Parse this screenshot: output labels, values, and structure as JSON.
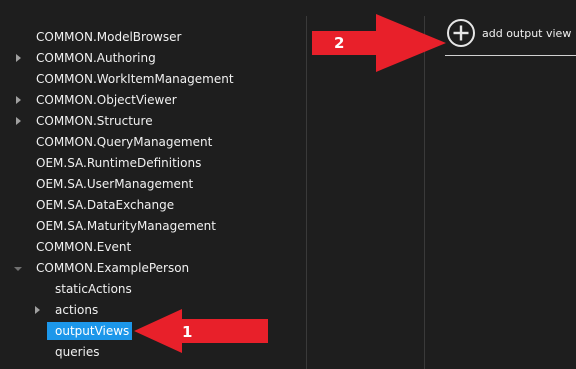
{
  "tree": {
    "items": [
      {
        "label": "COMMON.ModelBrowser",
        "expander": "none"
      },
      {
        "label": "COMMON.Authoring",
        "expander": "collapsed"
      },
      {
        "label": "COMMON.WorkItemManagement",
        "expander": "none"
      },
      {
        "label": "COMMON.ObjectViewer",
        "expander": "collapsed"
      },
      {
        "label": "COMMON.Structure",
        "expander": "collapsed"
      },
      {
        "label": "COMMON.QueryManagement",
        "expander": "none"
      },
      {
        "label": "OEM.SA.RuntimeDefinitions",
        "expander": "none"
      },
      {
        "label": "OEM.SA.UserManagement",
        "expander": "none"
      },
      {
        "label": "OEM.SA.DataExchange",
        "expander": "none"
      },
      {
        "label": "OEM.SA.MaturityManagement",
        "expander": "none"
      },
      {
        "label": "COMMON.Event",
        "expander": "none"
      },
      {
        "label": "COMMON.ExamplePerson",
        "expander": "expanded"
      },
      {
        "label": "staticActions",
        "expander": "none"
      },
      {
        "label": "actions",
        "expander": "collapsed"
      },
      {
        "label": "outputViews",
        "expander": "none",
        "selected": true
      },
      {
        "label": "queries",
        "expander": "none"
      }
    ]
  },
  "output_panel": {
    "add_button_label": "add output view",
    "add_icon": "plus-circle-icon"
  },
  "annotations": [
    {
      "number": "1",
      "color": "#e8202a",
      "target": "outputViews"
    },
    {
      "number": "2",
      "color": "#e8202a",
      "target": "add output view"
    }
  ],
  "colors": {
    "background": "#1e1e1e",
    "text": "#f1f1f1",
    "selection": "#1c97ea",
    "annotation": "#e8202a"
  }
}
